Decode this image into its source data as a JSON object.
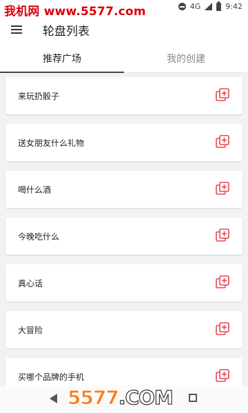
{
  "status": {
    "watermark": "我机网 www.5577.com",
    "time": "9:42",
    "network": "4G"
  },
  "appbar": {
    "title": "轮盘列表"
  },
  "tabs": [
    {
      "label": "推荐广场",
      "active": true
    },
    {
      "label": "我的创建",
      "active": false
    }
  ],
  "items": [
    {
      "label": "来玩扔骰子"
    },
    {
      "label": "送女朋友什么礼物"
    },
    {
      "label": "喝什么酒"
    },
    {
      "label": "今晚吃什么"
    },
    {
      "label": "真心话"
    },
    {
      "label": "大冒险"
    },
    {
      "label": "买哪个品牌的手机"
    }
  ],
  "brand_watermark": {
    "number": "5577",
    "domain": ".COM"
  },
  "colors": {
    "accent": "#e8454f",
    "watermark_red": "#d9000b",
    "background": "#f2f2f2"
  }
}
